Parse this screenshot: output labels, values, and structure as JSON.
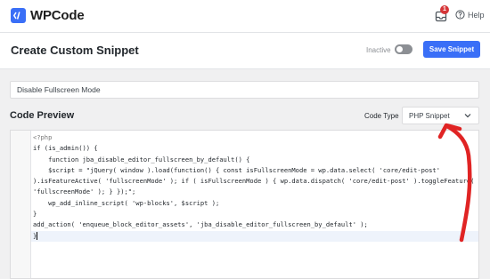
{
  "app": {
    "brand": "WPCode",
    "notification_count": "1",
    "help_label": "Help"
  },
  "header": {
    "title": "Create Custom Snippet",
    "status_label": "Inactive",
    "save_label": "Save Snippet"
  },
  "snippet": {
    "title_value": "Disable Fullscreen Mode"
  },
  "code_preview": {
    "section_title": "Code Preview",
    "code_type_label": "Code Type",
    "code_type_value": "PHP Snippet",
    "lines": [
      "<?php",
      "if (is_admin()) {",
      "    function jba_disable_editor_fullscreen_by_default() {",
      "    $script = \"jQuery( window ).load(function() { const isFullscreenMode = wp.data.select( 'core/edit-post'",
      ").isFeatureActive( 'fullscreenMode' ); if ( isFullscreenMode ) { wp.data.dispatch( 'core/edit-post' ).toggleFeature(",
      "'fullscreenMode' ); } });\";",
      "    wp_add_inline_script( 'wp-blocks', $script );",
      "}",
      "add_action( 'enqueue_block_editor_assets', 'jba_disable_editor_fullscreen_by_default' );",
      "}"
    ]
  },
  "colors": {
    "accent": "#3a6ff7",
    "annotation": "#e02424",
    "badge": "#d63638"
  },
  "icons": [
    "wpcode-logo-icon",
    "bell-icon",
    "help-icon",
    "chevron-down-icon",
    "annotation-arrow-icon"
  ]
}
